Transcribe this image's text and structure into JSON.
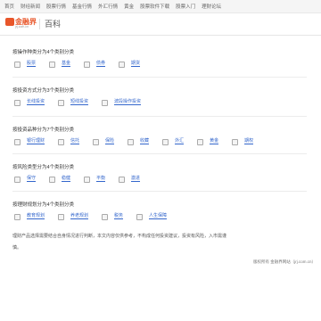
{
  "topnav": [
    "首页",
    "财经新闻",
    "股票行情",
    "基金行情",
    "外汇行情",
    "黄金",
    "股票软件下载",
    "股票入门",
    "理财论坛"
  ],
  "logo": {
    "text": "金融界",
    "sub": "jrj.com.cn"
  },
  "page_title": "百科",
  "colors": {
    "link": "#3366cc",
    "logo": "#e8562a"
  },
  "sections": [
    {
      "title": "按操作种类分为4个类别分类",
      "options": [
        "股票",
        "基金",
        "债券",
        "期货"
      ]
    },
    {
      "title": "按投资方式分为3个类别分类",
      "options": [
        "长线投资",
        "短线投资",
        "波段操作投资"
      ]
    },
    {
      "title": "按投资品种分为7个类别分类",
      "options": [
        "银行理财",
        "信托",
        "保险",
        "收藏",
        "外汇",
        "黄金",
        "期权"
      ]
    },
    {
      "title": "按风险类型分为4个类别分类",
      "options": [
        "保守",
        "稳健",
        "平衡",
        "激进"
      ]
    },
    {
      "title": "按理财规划分为4个类别分类",
      "options": [
        "教育规划",
        "养老规划",
        "税务",
        "人生保障"
      ]
    }
  ],
  "note": "理财产品选择需要结合自身情况进行判断，本文内容仅供参考，不构成任何投资建议，投资有风险，入市需谨慎。",
  "footer": "版权所有 金融界网站（jrj.com.cn）"
}
